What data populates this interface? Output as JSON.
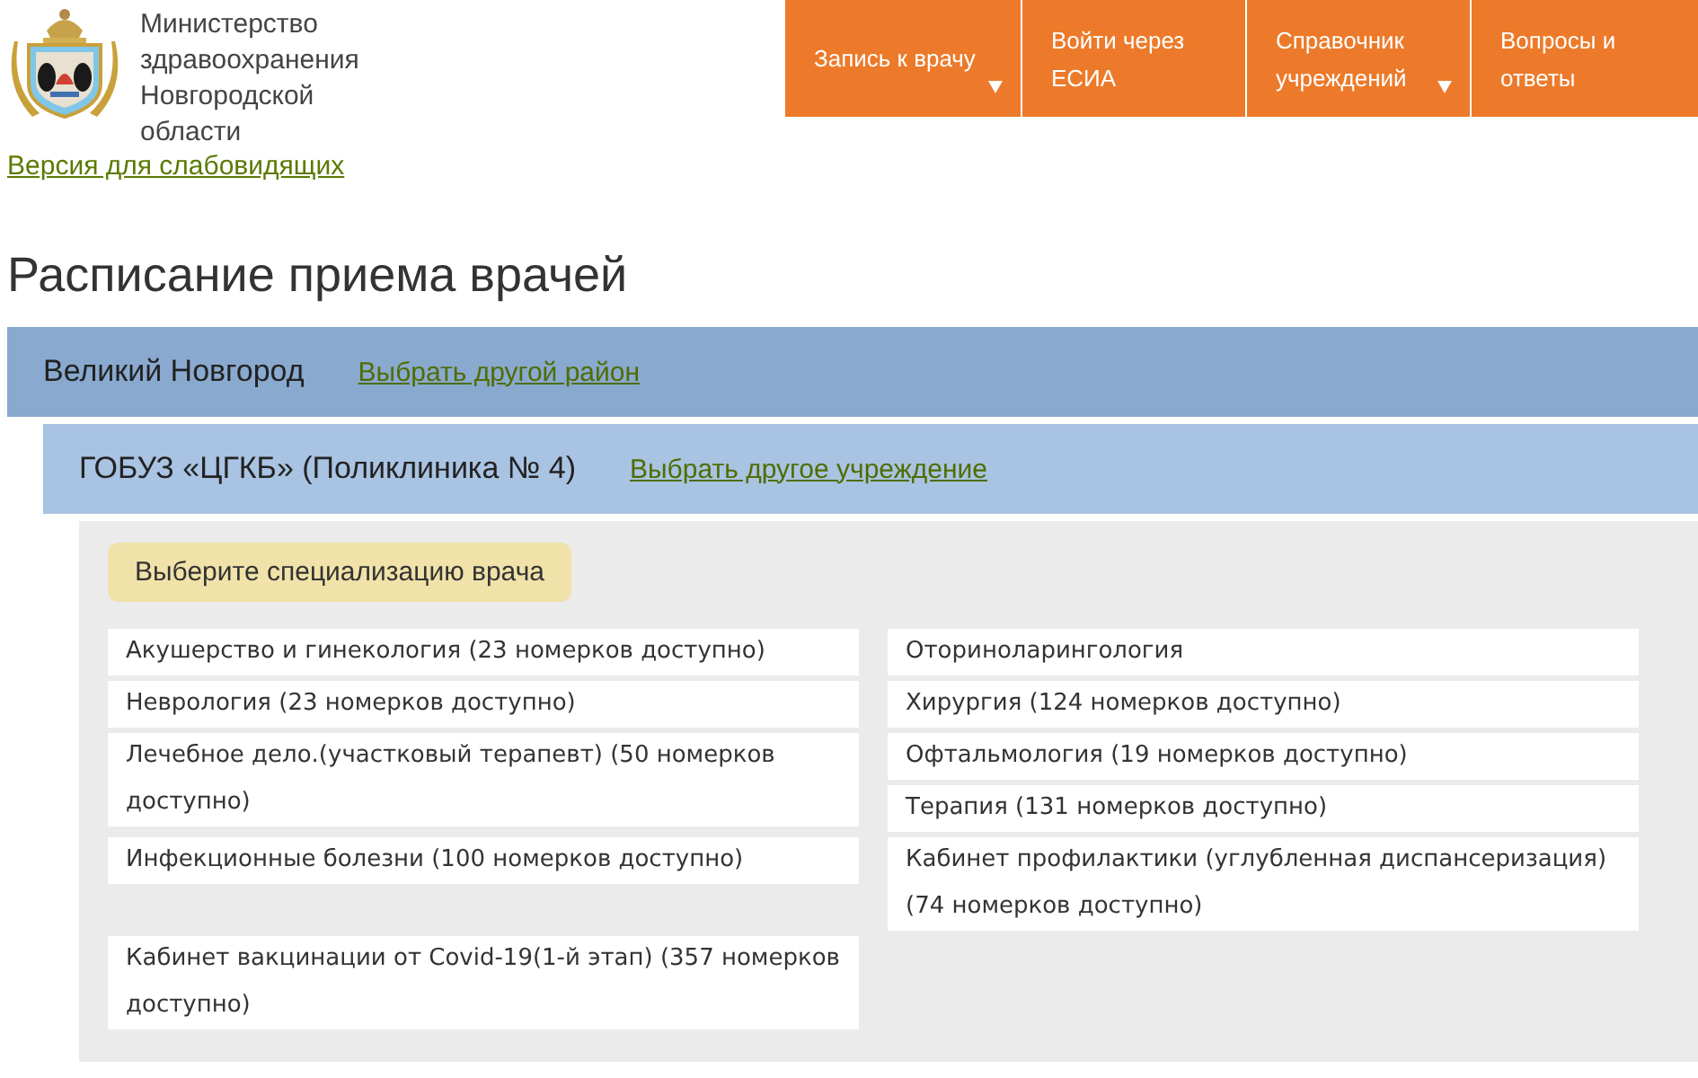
{
  "header": {
    "org_name": "Министерство здравоохранения Новгородской области",
    "accessibility_link": "Версия для слабовидящих"
  },
  "nav": [
    {
      "label": "Запись к врачу",
      "has_dropdown": true
    },
    {
      "label": "Войти через ЕСИА",
      "has_dropdown": false
    },
    {
      "label": "Справочник учреждений",
      "has_dropdown": true
    },
    {
      "label": "Вопросы и ответы",
      "has_dropdown": false
    }
  ],
  "title": "Расписание приема врачей",
  "district": {
    "name": "Великий Новгород",
    "change_link": "Выбрать другой район"
  },
  "institution": {
    "name": "ГОБУЗ «ЦГКБ» (Поликлиника № 4)",
    "change_link": "Выбрать другое учреждение"
  },
  "specialties": {
    "heading": "Выберите специализацию врача",
    "items": [
      "Акушерство и гинекология (23 номерков доступно)",
      "Оториноларингология",
      "Неврология (23 номерков доступно)",
      "Хирургия (124 номерков доступно)",
      "Лечебное дело.(участковый терапевт) (50 номерков доступно)",
      "Офтальмология (19 номерков доступно)",
      "Терапия (131 номерков доступно)",
      "Инфекционные болезни (100 номерков доступно)",
      "Кабинет профилактики (углубленная диспансеризация) (74 номерков доступно)",
      "Кабинет вакцинации от Covid-19(1-й этап) (357 номерков доступно)"
    ]
  }
}
